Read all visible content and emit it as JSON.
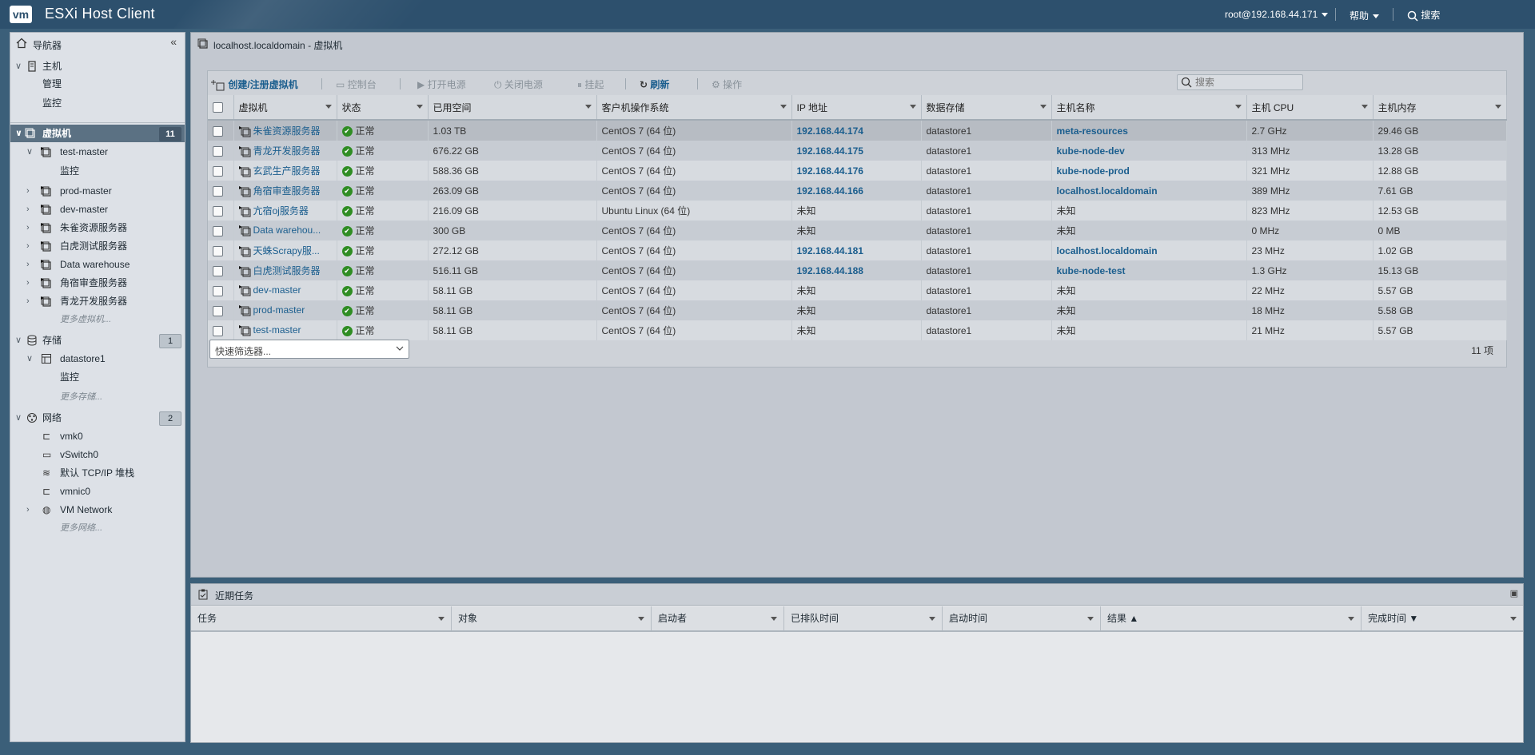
{
  "header": {
    "logo": "vm",
    "title": "ESXi Host Client",
    "user": "root@192.168.44.171",
    "help": "帮助",
    "search": "搜索"
  },
  "navigator": {
    "title": "导航器",
    "host": {
      "label": "主机",
      "children": [
        "管理",
        "监控"
      ]
    },
    "vms": {
      "label": "虚拟机",
      "count": "11",
      "items": [
        {
          "label": "test-master",
          "expanded": true,
          "child": "监控"
        },
        {
          "label": "prod-master"
        },
        {
          "label": "dev-master"
        },
        {
          "label": "朱雀资源服务器"
        },
        {
          "label": "白虎测试服务器"
        },
        {
          "label": "Data warehouse"
        },
        {
          "label": "角宿审查服务器"
        },
        {
          "label": "青龙开发服务器"
        }
      ],
      "more": "更多虚拟机..."
    },
    "storage": {
      "label": "存储",
      "count": "1",
      "item": "datastore1",
      "child": "监控",
      "more": "更多存储..."
    },
    "network": {
      "label": "网络",
      "count": "2",
      "items": [
        "vmk0",
        "vSwitch0",
        "默认 TCP/IP 堆栈",
        "vmnic0",
        "VM Network"
      ],
      "more": "更多网络..."
    }
  },
  "main": {
    "title": "localhost.localdomain - 虚拟机",
    "toolbar": {
      "create": "创建/注册虚拟机",
      "console": "控制台",
      "power_on": "打开电源",
      "power_off": "关闭电源",
      "suspend": "挂起",
      "refresh": "刷新",
      "actions": "操作",
      "search_placeholder": "搜索"
    },
    "columns": [
      "虚拟机",
      "状态",
      "已用空间",
      "客户机操作系统",
      "IP 地址",
      "数据存储",
      "主机名称",
      "主机 CPU",
      "主机内存"
    ],
    "rows": [
      {
        "name": "朱雀资源服务器",
        "status": "正常",
        "space": "1.03 TB",
        "os": "CentOS 7 (64 位)",
        "ip": "192.168.44.174",
        "ds": "datastore1",
        "host": "meta-resources",
        "cpu": "2.7 GHz",
        "mem": "29.46 GB"
      },
      {
        "name": "青龙开发服务器",
        "status": "正常",
        "space": "676.22 GB",
        "os": "CentOS 7 (64 位)",
        "ip": "192.168.44.175",
        "ds": "datastore1",
        "host": "kube-node-dev",
        "cpu": "313 MHz",
        "mem": "13.28 GB"
      },
      {
        "name": "玄武生产服务器",
        "status": "正常",
        "space": "588.36 GB",
        "os": "CentOS 7 (64 位)",
        "ip": "192.168.44.176",
        "ds": "datastore1",
        "host": "kube-node-prod",
        "cpu": "321 MHz",
        "mem": "12.88 GB"
      },
      {
        "name": "角宿审查服务器",
        "status": "正常",
        "space": "263.09 GB",
        "os": "CentOS 7 (64 位)",
        "ip": "192.168.44.166",
        "ds": "datastore1",
        "host": "localhost.localdomain",
        "cpu": "389 MHz",
        "mem": "7.61 GB"
      },
      {
        "name": "亢宿oj服务器",
        "status": "正常",
        "space": "216.09 GB",
        "os": "Ubuntu Linux (64 位)",
        "ip": "未知",
        "ds": "datastore1",
        "host": "未知",
        "cpu": "823 MHz",
        "mem": "12.53 GB"
      },
      {
        "name": "Data warehou...",
        "status": "正常",
        "space": "300 GB",
        "os": "CentOS 7 (64 位)",
        "ip": "未知",
        "ds": "datastore1",
        "host": "未知",
        "cpu": "0 MHz",
        "mem": "0 MB"
      },
      {
        "name": "天蛛Scrapy服...",
        "status": "正常",
        "space": "272.12 GB",
        "os": "CentOS 7 (64 位)",
        "ip": "192.168.44.181",
        "ds": "datastore1",
        "host": "localhost.localdomain",
        "cpu": "23 MHz",
        "mem": "1.02 GB"
      },
      {
        "name": "白虎测试服务器",
        "status": "正常",
        "space": "516.11 GB",
        "os": "CentOS 7 (64 位)",
        "ip": "192.168.44.188",
        "ds": "datastore1",
        "host": "kube-node-test",
        "cpu": "1.3 GHz",
        "mem": "15.13 GB"
      },
      {
        "name": "dev-master",
        "status": "正常",
        "space": "58.11 GB",
        "os": "CentOS 7 (64 位)",
        "ip": "未知",
        "ds": "datastore1",
        "host": "未知",
        "cpu": "22 MHz",
        "mem": "5.57 GB"
      },
      {
        "name": "prod-master",
        "status": "正常",
        "space": "58.11 GB",
        "os": "CentOS 7 (64 位)",
        "ip": "未知",
        "ds": "datastore1",
        "host": "未知",
        "cpu": "18 MHz",
        "mem": "5.58 GB"
      },
      {
        "name": "test-master",
        "status": "正常",
        "space": "58.11 GB",
        "os": "CentOS 7 (64 位)",
        "ip": "未知",
        "ds": "datastore1",
        "host": "未知",
        "cpu": "21 MHz",
        "mem": "5.57 GB"
      }
    ],
    "filter_placeholder": "快速筛选器...",
    "count": "11 项"
  },
  "tasks": {
    "title": "近期任务",
    "columns": [
      "任务",
      "对象",
      "启动者",
      "已排队时间",
      "启动时间",
      "结果 ▲",
      "完成时间 ▼"
    ]
  },
  "colors": {
    "header": "#2d506d",
    "link": "#1b5e8e",
    "status_ok": "#2f8d23"
  }
}
